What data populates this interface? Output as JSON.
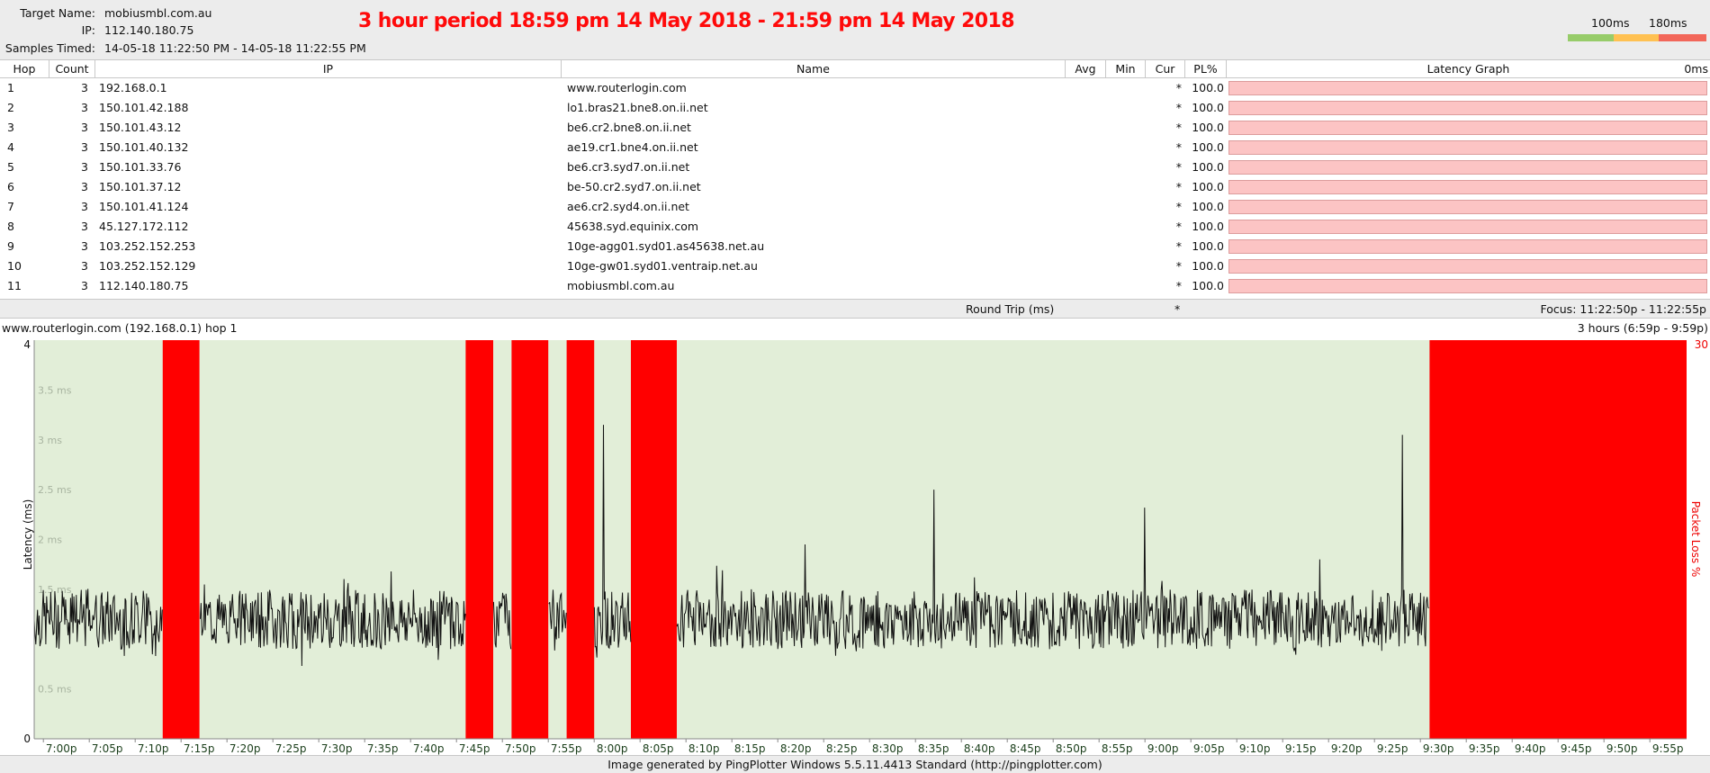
{
  "header": {
    "target_name_label": "Target Name:",
    "target_name": "mobiusmbl.com.au",
    "ip_label": "IP:",
    "ip": "112.140.180.75",
    "samples_label": "Samples Timed:",
    "samples": "14-05-18 11:22:50 PM - 14-05-18 11:22:55 PM",
    "banner": "3 hour period 18:59 pm 14 May 2018 - 21:59 pm 14 May 2018",
    "legend": {
      "label_100": "100ms",
      "label_180": "180ms",
      "colors": [
        "#97cc6a",
        "#ffc152",
        "#f2675a"
      ]
    }
  },
  "table": {
    "columns": [
      "Hop",
      "Count",
      "IP",
      "Name",
      "Avg",
      "Min",
      "Cur",
      "PL%",
      "Latency Graph",
      "0ms"
    ],
    "rows": [
      {
        "hop": "1",
        "count": "3",
        "ip": "192.168.0.1",
        "name": "www.routerlogin.com",
        "cur": "*",
        "pl": "100.0"
      },
      {
        "hop": "2",
        "count": "3",
        "ip": "150.101.42.188",
        "name": "lo1.bras21.bne8.on.ii.net",
        "cur": "*",
        "pl": "100.0"
      },
      {
        "hop": "3",
        "count": "3",
        "ip": "150.101.43.12",
        "name": "be6.cr2.bne8.on.ii.net",
        "cur": "*",
        "pl": "100.0"
      },
      {
        "hop": "4",
        "count": "3",
        "ip": "150.101.40.132",
        "name": "ae19.cr1.bne4.on.ii.net",
        "cur": "*",
        "pl": "100.0"
      },
      {
        "hop": "5",
        "count": "3",
        "ip": "150.101.33.76",
        "name": "be6.cr3.syd7.on.ii.net",
        "cur": "*",
        "pl": "100.0"
      },
      {
        "hop": "6",
        "count": "3",
        "ip": "150.101.37.12",
        "name": "be-50.cr2.syd7.on.ii.net",
        "cur": "*",
        "pl": "100.0"
      },
      {
        "hop": "7",
        "count": "3",
        "ip": "150.101.41.124",
        "name": "ae6.cr2.syd4.on.ii.net",
        "cur": "*",
        "pl": "100.0"
      },
      {
        "hop": "8",
        "count": "3",
        "ip": "45.127.172.112",
        "name": "45638.syd.equinix.com",
        "cur": "*",
        "pl": "100.0"
      },
      {
        "hop": "9",
        "count": "3",
        "ip": "103.252.152.253",
        "name": "10ge-agg01.syd01.as45638.net.au",
        "cur": "*",
        "pl": "100.0"
      },
      {
        "hop": "10",
        "count": "3",
        "ip": "103.252.152.129",
        "name": "10ge-gw01.syd01.ventraip.net.au",
        "cur": "*",
        "pl": "100.0"
      },
      {
        "hop": "11",
        "count": "3",
        "ip": "112.140.180.75",
        "name": "mobiusmbl.com.au",
        "cur": "*",
        "pl": "100.0"
      }
    ],
    "summary": {
      "label": "Round Trip (ms)",
      "cur": "*",
      "focus": "Focus: 11:22:50p - 11:22:55p"
    }
  },
  "graph": {
    "title": "www.routerlogin.com (192.168.0.1) hop 1",
    "period": "3 hours (6:59p - 9:59p)"
  },
  "chart_data": {
    "type": "line",
    "title": "",
    "xlabel": "",
    "ylabel": "Latency (ms)",
    "y2label": "Packet Loss %",
    "ylim": [
      0,
      4
    ],
    "y2lim": [
      0,
      30
    ],
    "y_axis_ticks": [
      "0",
      "4"
    ],
    "y2_axis_ticks": [
      "30"
    ],
    "y_gridline_labels": [
      "0.5 ms",
      "1.5 ms",
      "2 ms",
      "2.5 ms",
      "3 ms",
      "3.5 ms"
    ],
    "x_start": "6:59p",
    "x_end": "9:59p",
    "x_ticks": [
      "7:00p",
      "7:05p",
      "7:10p",
      "7:15p",
      "7:20p",
      "7:25p",
      "7:30p",
      "7:35p",
      "7:40p",
      "7:45p",
      "7:50p",
      "7:55p",
      "8:00p",
      "8:05p",
      "8:10p",
      "8:15p",
      "8:20p",
      "8:25p",
      "8:30p",
      "8:35p",
      "8:40p",
      "8:45p",
      "8:50p",
      "8:55p",
      "9:00p",
      "9:05p",
      "9:10p",
      "9:15p",
      "9:20p",
      "9:25p",
      "9:30p",
      "9:35p",
      "9:40p",
      "9:45p",
      "9:50p",
      "9:55p"
    ],
    "packet_loss_periods": [
      {
        "start": "7:13p",
        "end": "7:17p",
        "loss_pct": 100
      },
      {
        "start": "7:46p",
        "end": "7:49p",
        "loss_pct": 100
      },
      {
        "start": "7:51p",
        "end": "7:55p",
        "loss_pct": 100
      },
      {
        "start": "7:57p",
        "end": "8:00p",
        "loss_pct": 100
      },
      {
        "start": "8:04p",
        "end": "8:09p",
        "loss_pct": 100
      },
      {
        "start": "9:31p",
        "end": "9:59p",
        "loss_pct": 100
      }
    ],
    "latency_series": {
      "name": "",
      "typical_range_ms": [
        0.9,
        1.5
      ],
      "spikes": [
        {
          "time": "8:01p",
          "value": 3.15
        },
        {
          "time": "8:23p",
          "value": 1.95
        },
        {
          "time": "8:37p",
          "value": 2.5
        },
        {
          "time": "9:00p",
          "value": 2.32
        },
        {
          "time": "9:19p",
          "value": 1.8
        },
        {
          "time": "9:28p",
          "value": 3.05
        }
      ]
    },
    "colors": {
      "background": "#e2eed8",
      "packet_loss": "#ff0000",
      "line": "#111111"
    }
  },
  "footer": {
    "text": "Image generated by PingPlotter Windows 5.5.11.4413 Standard (http://pingplotter.com)"
  }
}
